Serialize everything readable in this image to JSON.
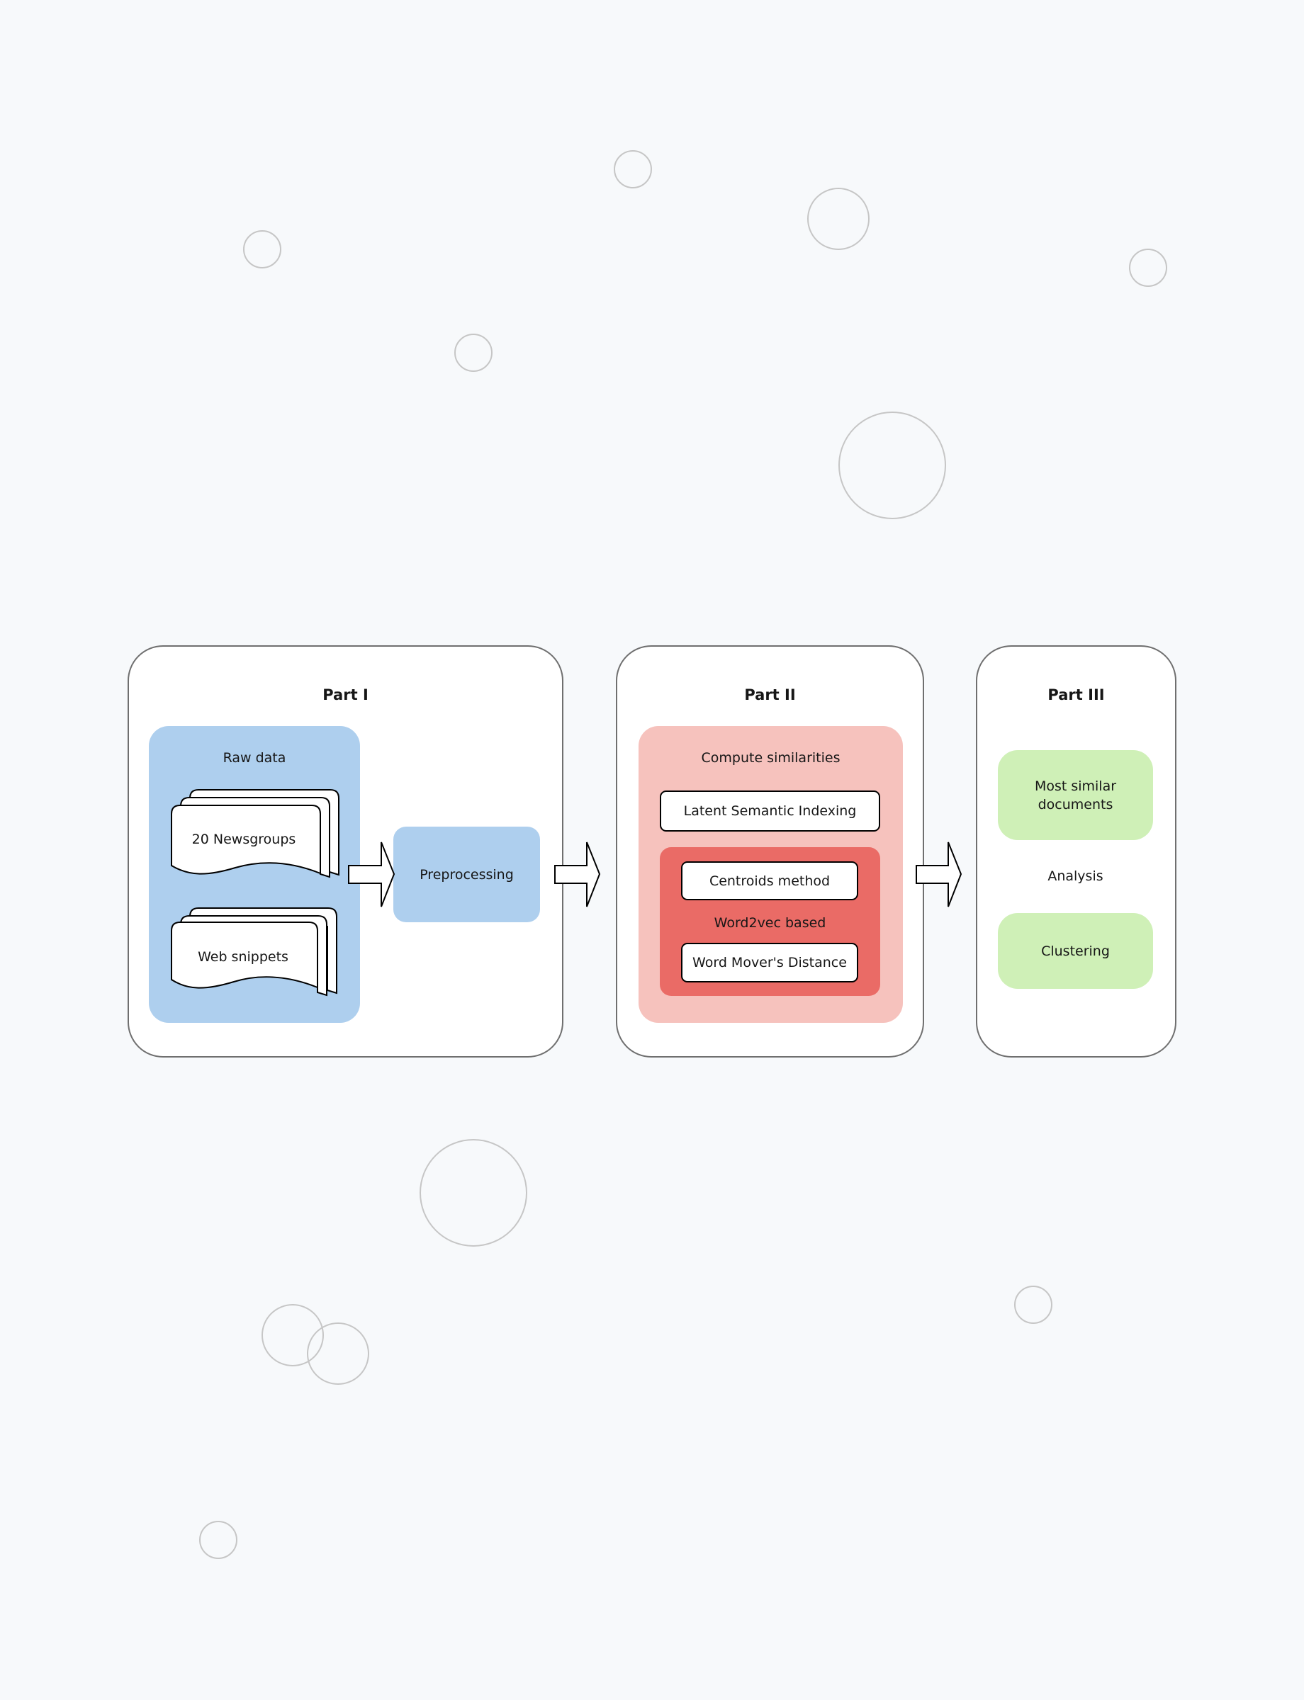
{
  "diagram": {
    "background_circles_count": 12,
    "colors": {
      "background": "#f7f9fb",
      "part_border": "#6f6f6f",
      "data_blue": "#aecfee",
      "similarity_pink": "#f6c2bd",
      "word2vec_red": "#ea6b66",
      "analysis_green": "#cff0b7",
      "circle_stroke": "#c6c6c6"
    },
    "part1": {
      "title": "Part I",
      "raw_data": {
        "label": "Raw data",
        "datasets": [
          {
            "label": "20 Newsgroups"
          },
          {
            "label": "Web snippets"
          }
        ]
      },
      "preprocessing": {
        "label": "Preprocessing"
      }
    },
    "part2": {
      "title": "Part II",
      "compute": {
        "label": "Compute similarities",
        "lsi": {
          "label": "Latent Semantic Indexing"
        },
        "word2vec": {
          "label": "Word2vec based",
          "centroids": {
            "label": "Centroids method"
          },
          "wmd": {
            "label": "Word Mover's Distance"
          }
        }
      }
    },
    "part3": {
      "title": "Part III",
      "most_similar": {
        "label": "Most similar documents"
      },
      "analysis": {
        "label": "Analysis"
      },
      "clustering": {
        "label": "Clustering"
      }
    },
    "flow": [
      {
        "from": "Raw data",
        "to": "Preprocessing"
      },
      {
        "from": "Part I",
        "to": "Part II"
      },
      {
        "from": "Part II",
        "to": "Part III"
      }
    ]
  }
}
